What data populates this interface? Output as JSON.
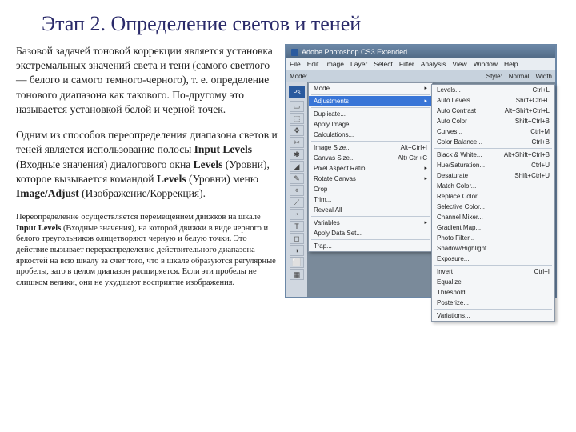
{
  "slide": {
    "title": "Этап 2. Определение светов и теней",
    "p1": "Базовой задачей тоновой коррекции является установка экстремальных значений света и тени (самого светлого — белого и самого темного-черного), т. е. определение тонового диапазона как такового. По-другому это называется установкой белой и черной точек.",
    "p2_a": "Одним из способов переопределения диапазона светов и теней является использование полосы ",
    "p2_b": "Input Levels",
    "p2_c": " (Входные значения) диалогового окна ",
    "p2_d": "Levels",
    "p2_e": " (Уровни), которое вызывается командой ",
    "p2_f": "Levels",
    "p2_g": " (Уровни) меню ",
    "p2_h": "Image/Adjust",
    "p2_i": " (Изображение/Коррекция).",
    "p3_a": "Переопределение осуществляется перемещением движков на шкале ",
    "p3_b": "Input Levels",
    "p3_c": " (Входные значения), на которой движки в виде черного и белого треугольников олицетворяют черную и белую точки. Это действие вызывает перераспределение действительного диапазона яркостей на всю шкалу за счет того, что в шкале образуются регулярные пробелы, зато в целом диапазон расширяется. Если эти пробелы не слишком велики, они не ухудшают восприятие изображения."
  },
  "ps": {
    "title": "Adobe Photoshop CS3 Extended",
    "menu": [
      "File",
      "Edit",
      "Image",
      "Layer",
      "Select",
      "Filter",
      "Analysis",
      "View",
      "Window",
      "Help"
    ],
    "opt": {
      "mode": "Mode:",
      "style": "Style:",
      "normal": "Normal",
      "width": "Width"
    },
    "tools": [
      "▭",
      "⬚",
      "✥",
      "✂",
      "✱",
      "◢",
      "✎",
      "⌖",
      "⟋",
      "◔",
      "T",
      "◻",
      "◑",
      "⬜",
      "▦"
    ],
    "pslabel": "Ps",
    "imgmenu": [
      {
        "l": "Mode",
        "t": "arrow"
      },
      {
        "t": "sep"
      },
      {
        "l": "Adjustments",
        "t": "arrow",
        "hl": true
      },
      {
        "t": "sep"
      },
      {
        "l": "Duplicate..."
      },
      {
        "l": "Apply Image..."
      },
      {
        "l": "Calculations..."
      },
      {
        "t": "sep"
      },
      {
        "l": "Image Size...",
        "s": "Alt+Ctrl+I"
      },
      {
        "l": "Canvas Size...",
        "s": "Alt+Ctrl+C"
      },
      {
        "l": "Pixel Aspect Ratio",
        "t": "arrow"
      },
      {
        "l": "Rotate Canvas",
        "t": "arrow"
      },
      {
        "l": "Crop"
      },
      {
        "l": "Trim..."
      },
      {
        "l": "Reveal All"
      },
      {
        "t": "sep"
      },
      {
        "l": "Variables",
        "t": "arrow"
      },
      {
        "l": "Apply Data Set..."
      },
      {
        "t": "sep"
      },
      {
        "l": "Trap..."
      }
    ],
    "adjmenu": [
      {
        "l": "Levels...",
        "s": "Ctrl+L"
      },
      {
        "l": "Auto Levels",
        "s": "Shift+Ctrl+L"
      },
      {
        "l": "Auto Contrast",
        "s": "Alt+Shift+Ctrl+L"
      },
      {
        "l": "Auto Color",
        "s": "Shift+Ctrl+B"
      },
      {
        "l": "Curves...",
        "s": "Ctrl+M"
      },
      {
        "l": "Color Balance...",
        "s": "Ctrl+B"
      },
      {
        "t": "sep"
      },
      {
        "l": "Black & White...",
        "s": "Alt+Shift+Ctrl+B"
      },
      {
        "l": "Hue/Saturation...",
        "s": "Ctrl+U"
      },
      {
        "l": "Desaturate",
        "s": "Shift+Ctrl+U"
      },
      {
        "l": "Match Color..."
      },
      {
        "l": "Replace Color..."
      },
      {
        "l": "Selective Color..."
      },
      {
        "l": "Channel Mixer..."
      },
      {
        "l": "Gradient Map..."
      },
      {
        "l": "Photo Filter..."
      },
      {
        "l": "Shadow/Highlight..."
      },
      {
        "l": "Exposure..."
      },
      {
        "t": "sep"
      },
      {
        "l": "Invert",
        "s": "Ctrl+I"
      },
      {
        "l": "Equalize"
      },
      {
        "l": "Threshold..."
      },
      {
        "l": "Posterize..."
      },
      {
        "t": "sep"
      },
      {
        "l": "Variations..."
      }
    ]
  }
}
